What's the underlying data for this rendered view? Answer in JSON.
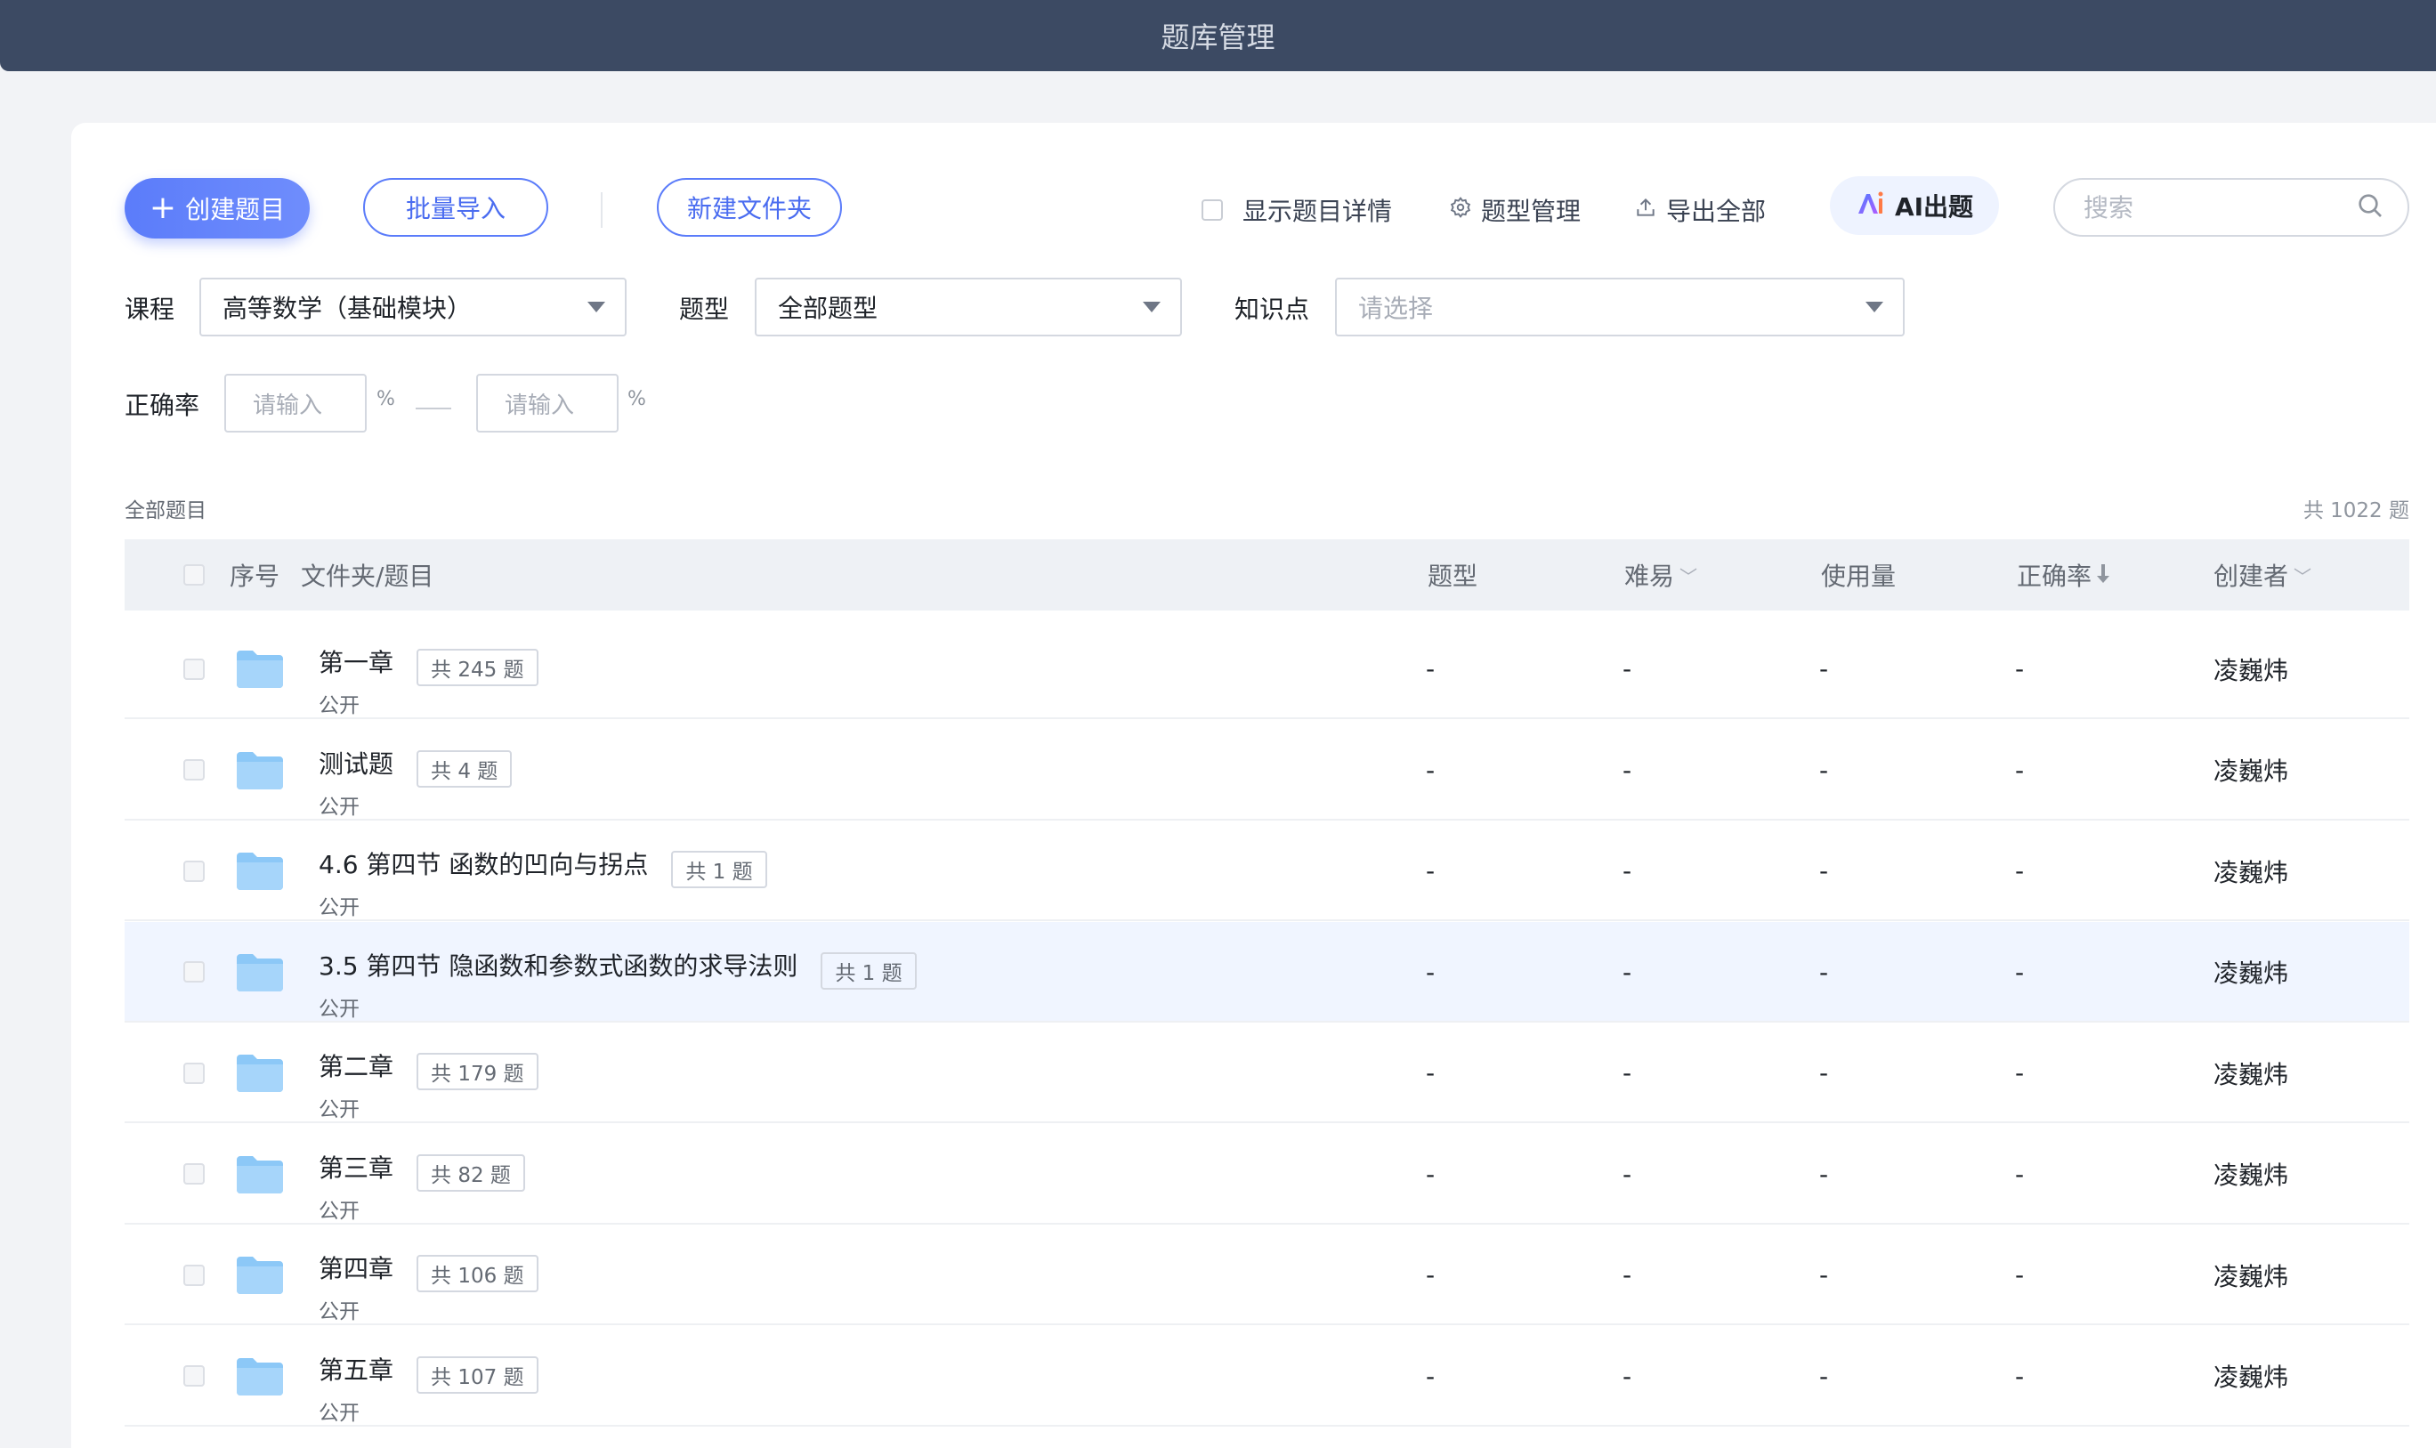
{
  "window": {
    "title": "题库管理"
  },
  "toolbar": {
    "create_label": "创建题目",
    "batch_import_label": "批量导入",
    "new_folder_label": "新建文件夹",
    "show_detail_label": "显示题目详情",
    "type_manage_label": "题型管理",
    "export_all_label": "导出全部",
    "ai_label": "AI出题",
    "search_placeholder": "搜索"
  },
  "filters": {
    "course_label": "课程",
    "course_value": "高等数学（基础模块）",
    "type_label": "题型",
    "type_value": "全部题型",
    "knowledge_label": "知识点",
    "knowledge_placeholder": "请选择",
    "accuracy_label": "正确率",
    "accuracy_min_placeholder": "请输入",
    "accuracy_max_placeholder": "请输入",
    "percent_sign": "%"
  },
  "list": {
    "section_title": "全部题目",
    "total_text": "共 1022 题",
    "columns": {
      "index": "序号",
      "name": "文件夹/题目",
      "type": "题型",
      "difficulty": "难易",
      "usage": "使用量",
      "accuracy": "正确率",
      "creator": "创建者"
    },
    "rows": [
      {
        "name": "第一章",
        "count": "共 245 题",
        "visibility": "公开",
        "type": "-",
        "difficulty": "-",
        "usage": "-",
        "accuracy": "-",
        "creator": "凌巍炜"
      },
      {
        "name": "测试题",
        "count": "共 4 题",
        "visibility": "公开",
        "type": "-",
        "difficulty": "-",
        "usage": "-",
        "accuracy": "-",
        "creator": "凌巍炜"
      },
      {
        "name": "4.6 第四节 函数的凹向与拐点",
        "count": "共 1 题",
        "visibility": "公开",
        "type": "-",
        "difficulty": "-",
        "usage": "-",
        "accuracy": "-",
        "creator": "凌巍炜"
      },
      {
        "name": "3.5 第四节 隐函数和参数式函数的求导法则",
        "count": "共 1 题",
        "visibility": "公开",
        "type": "-",
        "difficulty": "-",
        "usage": "-",
        "accuracy": "-",
        "creator": "凌巍炜"
      },
      {
        "name": "第二章",
        "count": "共 179 题",
        "visibility": "公开",
        "type": "-",
        "difficulty": "-",
        "usage": "-",
        "accuracy": "-",
        "creator": "凌巍炜"
      },
      {
        "name": "第三章",
        "count": "共 82 题",
        "visibility": "公开",
        "type": "-",
        "difficulty": "-",
        "usage": "-",
        "accuracy": "-",
        "creator": "凌巍炜"
      },
      {
        "name": "第四章",
        "count": "共 106 题",
        "visibility": "公开",
        "type": "-",
        "difficulty": "-",
        "usage": "-",
        "accuracy": "-",
        "creator": "凌巍炜"
      },
      {
        "name": "第五章",
        "count": "共 107 题",
        "visibility": "公开",
        "type": "-",
        "difficulty": "-",
        "usage": "-",
        "accuracy": "-",
        "creator": "凌巍炜"
      }
    ]
  },
  "colors": {
    "title_bar": "#3c4a63",
    "accent": "#5b7cfa",
    "row_highlight": "#f0f5ff",
    "folder": "#8cc8f7"
  }
}
